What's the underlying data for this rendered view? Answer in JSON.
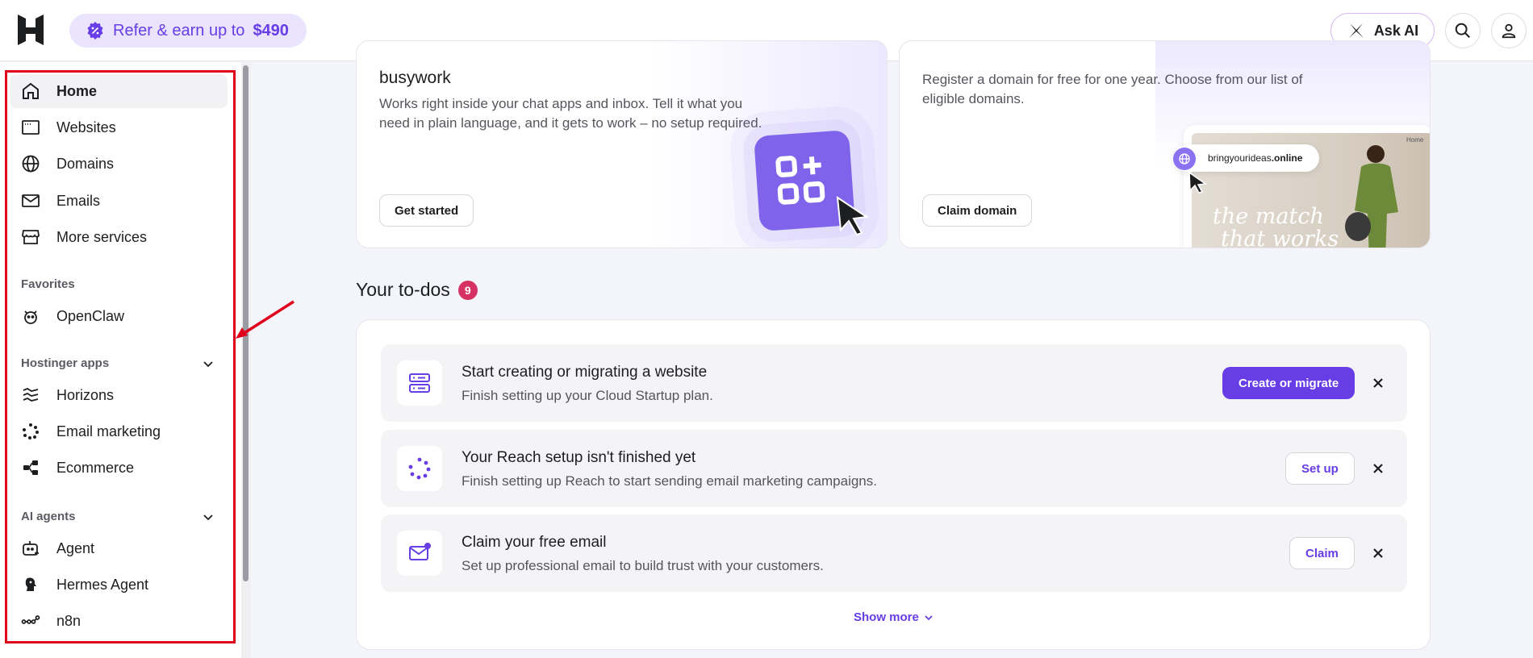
{
  "header": {
    "refer_text": "Refer & earn up to",
    "refer_amount": "$490",
    "ask_ai_label": "Ask AI"
  },
  "sidebar": {
    "main_items": [
      {
        "label": "Home",
        "icon": "home-icon"
      },
      {
        "label": "Websites",
        "icon": "browser-icon"
      },
      {
        "label": "Domains",
        "icon": "globe-icon"
      },
      {
        "label": "Emails",
        "icon": "mail-icon"
      },
      {
        "label": "More services",
        "icon": "store-icon"
      }
    ],
    "favorites_label": "Favorites",
    "favorites": [
      {
        "label": "OpenClaw",
        "icon": "claw-icon"
      }
    ],
    "apps_label": "Hostinger apps",
    "apps": [
      {
        "label": "Horizons",
        "icon": "horizons-icon"
      },
      {
        "label": "Email marketing",
        "icon": "spinner-icon"
      },
      {
        "label": "Ecommerce",
        "icon": "share-icon"
      }
    ],
    "agents_label": "AI agents",
    "agents": [
      {
        "label": "Agent",
        "icon": "robot-icon"
      },
      {
        "label": "Hermes Agent",
        "icon": "hermes-icon"
      },
      {
        "label": "n8n",
        "icon": "n8n-icon"
      }
    ]
  },
  "cards": {
    "busywork": {
      "title": "busywork",
      "desc": "Works right inside your chat apps and inbox. Tell it what you need in plain language, and it gets to work – no setup required.",
      "button": "Get started"
    },
    "domain": {
      "desc": "Register a domain for free for one year. Choose from our list of eligible domains.",
      "button": "Claim domain",
      "url_prefix": "bringyourideas",
      "url_suffix": ".online",
      "preview_line1": "the match",
      "preview_line2": "that works",
      "preview_tag": "Home"
    }
  },
  "todos": {
    "title": "Your to-dos",
    "count": "9",
    "items": [
      {
        "title": "Start creating or migrating a website",
        "sub": "Finish setting up your Cloud Startup plan.",
        "button": "Create or migrate",
        "icon": "server-icon"
      },
      {
        "title": "Your Reach setup isn't finished yet",
        "sub": "Finish setting up Reach to start sending email marketing campaigns.",
        "button": "Set up",
        "icon": "reach-icon"
      },
      {
        "title": "Claim your free email",
        "sub": "Set up professional email to build trust with your customers.",
        "button": "Claim",
        "icon": "email-badge-icon"
      }
    ],
    "show_more": "Show more"
  },
  "colors": {
    "brand": "#673de6",
    "badge": "#d63163",
    "highlight": "#e0001b"
  }
}
